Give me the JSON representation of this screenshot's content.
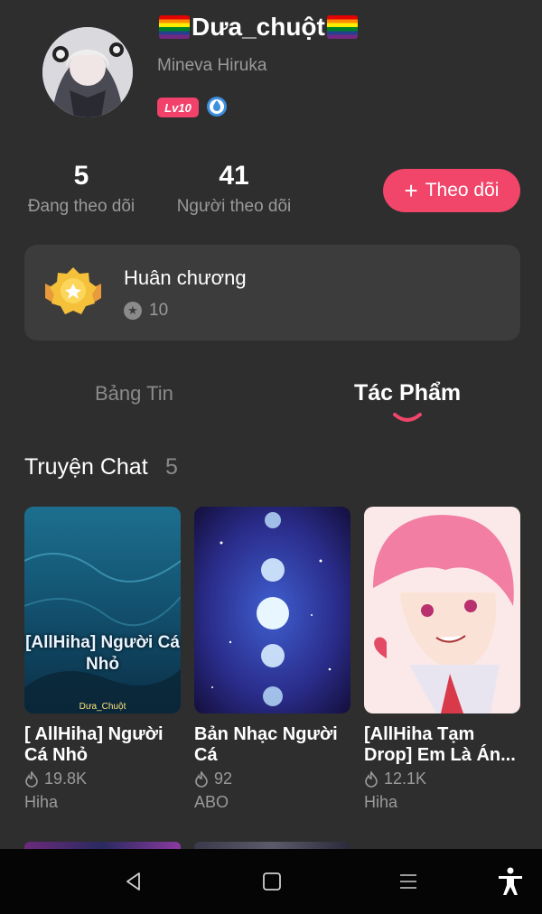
{
  "profile": {
    "username": "Dưa_chuột",
    "handle": "Mineva Hiruka",
    "level": "Lv10"
  },
  "stats": {
    "following_count": "5",
    "following_label": "Đang theo dõi",
    "followers_count": "41",
    "followers_label": "Người theo dõi"
  },
  "follow_button": {
    "label": "Theo dõi"
  },
  "medals": {
    "title": "Huân chương",
    "count": "10"
  },
  "tabs": [
    {
      "label": "Bảng Tin",
      "active": false
    },
    {
      "label": "Tác Phẩm",
      "active": true
    }
  ],
  "section": {
    "title": "Truyện Chat",
    "count": "5"
  },
  "stories": [
    {
      "title": "[ AllHiha] Người Cá Nhỏ",
      "views": "19.8K",
      "tag": "Hiha",
      "cover_text": "[AllHiha] Người Cá Nhỏ",
      "cover_credit": "Dưa_Chuột"
    },
    {
      "title": "Bản Nhạc Người Cá",
      "views": "92",
      "tag": "ABO"
    },
    {
      "title": "[AllHiha Tạm Drop] Em Là Án...",
      "views": "12.1K",
      "tag": "Hiha"
    }
  ],
  "colors": {
    "accent": "#f1456a",
    "background": "#2e2e2e",
    "card": "#3c3c3c"
  },
  "icons": {
    "nav": [
      "back-icon",
      "home-icon",
      "menu-icon",
      "accessibility-icon"
    ]
  }
}
